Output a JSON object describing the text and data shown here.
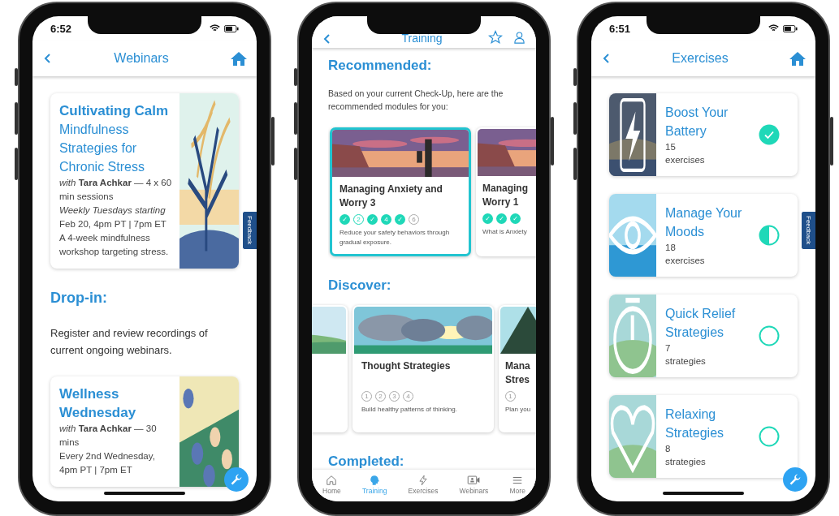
{
  "webinars_screen": {
    "status_time": "6:52",
    "title": "Webinars",
    "feedback_tab": "Feedback",
    "items": [
      {
        "kind": "webinar",
        "title": "Cultivating Calm",
        "subtitle": "Mindfulness Strategies for Chronic Stress",
        "byline": "*with* **Tara Achkar** — 4 x 60 min sessions",
        "schedule_note": "Weekly Tuesdays starting",
        "schedule": "Feb 20, 4pm PT | 7pm ET",
        "description": "A 4-week mindfulness workshop targeting stress."
      },
      {
        "kind": "heading",
        "text": "Drop-in:"
      },
      {
        "kind": "paragraph",
        "text": "Register and review recordings of current ongoing webinars."
      },
      {
        "kind": "webinar",
        "title": "Wellness Wednesday",
        "byline": "*with* **Tara Achkar** — 30 mins",
        "schedule": "Every 2nd Wednesday, 4pm PT | 7pm ET"
      }
    ]
  },
  "training_screen": {
    "title": "Training",
    "recommended_heading": "Recommended:",
    "intro": "Based on your current Check-Up, here are the recommended modules for you:",
    "modules": [
      {
        "title": "Managing Anxiety and Worry 3",
        "selected": true,
        "steps": [
          {
            "label": "✓",
            "done": true
          },
          {
            "label": "2",
            "done": false,
            "started": true
          },
          {
            "label": "✓",
            "done": true
          },
          {
            "label": "4",
            "done": true
          },
          {
            "label": "✓",
            "done": true
          },
          {
            "label": "6",
            "done": false,
            "started": false
          }
        ],
        "description": "Reduce your safety behaviors through gradual exposure."
      },
      {
        "title": "Managing\nWorry 1",
        "selected": false,
        "steps": [
          {
            "label": "✓",
            "done": true
          },
          {
            "label": "✓",
            "done": true
          },
          {
            "label": "✓",
            "done": true
          }
        ],
        "description": "What is Anxiety"
      }
    ],
    "discover_heading": "Discover:",
    "discover": [
      {
        "kind": "picture"
      },
      {
        "title": "Thought Strategies",
        "steps": [
          {
            "label": "1",
            "done": false,
            "started": false
          },
          {
            "label": "2",
            "done": false,
            "started": false
          },
          {
            "label": "3",
            "done": false,
            "started": false
          },
          {
            "label": "4",
            "done": false,
            "started": false
          }
        ],
        "description": "Build healthy patterns of thinking."
      },
      {
        "title": "Mana\nStres",
        "steps": [
          {
            "label": "1",
            "done": false,
            "started": false
          }
        ],
        "description": "Plan you"
      }
    ],
    "completed_heading": "Completed:",
    "nav": [
      {
        "label": "Home",
        "selected": false
      },
      {
        "label": "Training",
        "selected": true
      },
      {
        "label": "Exercises",
        "selected": false
      },
      {
        "label": "Webinars",
        "selected": false
      },
      {
        "label": "More",
        "selected": false
      }
    ]
  },
  "exercises_screen": {
    "status_time": "6:51",
    "title": "Exercises",
    "feedback_tab": "Feedback",
    "items": [
      {
        "title": "Boost Your Battery",
        "count": "15",
        "unit": "exercises",
        "completed": true
      },
      {
        "title": "Manage Your Moods",
        "count": "18",
        "unit": "exercises",
        "completed": false,
        "started": true
      },
      {
        "title": "Quick Relief Strategies",
        "count": "7",
        "unit": "strategies",
        "completed": false,
        "started": false
      },
      {
        "title": "Relaxing Strategies",
        "count": "8",
        "unit": "strategies",
        "completed": false,
        "started": false
      }
    ]
  }
}
